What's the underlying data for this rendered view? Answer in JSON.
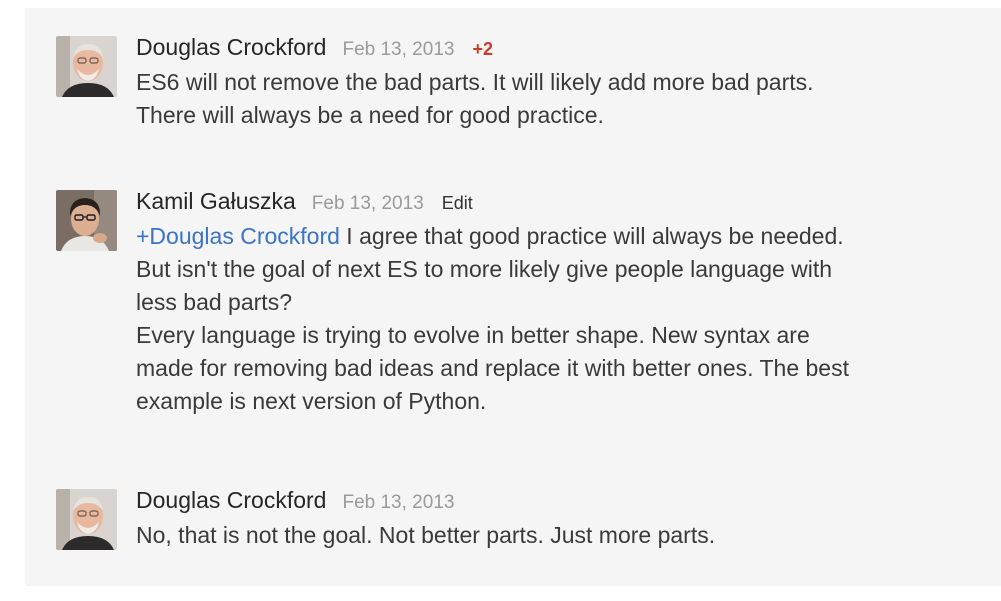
{
  "comments": [
    {
      "author": "Douglas Crockford",
      "date": "Feb 13, 2013",
      "plus_count": "+2",
      "lines": [
        "ES6 will not remove the bad parts. It will likely add more bad parts.",
        "There will always be a need for good practice."
      ]
    },
    {
      "author": "Kamil Gałuszka",
      "date": "Feb 13, 2013",
      "edit_label": "Edit",
      "mention": "+Douglas Crockford",
      "lines": [
        " I agree that good practice will always be needed.",
        "But isn't the goal of next ES to more likely give people language with",
        "less bad parts?",
        "Every language is trying to evolve in better shape. New syntax are",
        "made for removing bad ideas and replace it with better ones. The best",
        "example is next version of Python."
      ]
    },
    {
      "author": "Douglas Crockford",
      "date": "Feb 13, 2013",
      "lines": [
        "No, that is not the goal. Not better parts. Just more parts."
      ]
    }
  ],
  "colors": {
    "panel_background": "#f5f5f5",
    "author": "#262626",
    "date": "#9a9a9a",
    "plus_one": "#d0392b",
    "mention": "#3b73c8",
    "body_text": "#3a3a3a"
  }
}
